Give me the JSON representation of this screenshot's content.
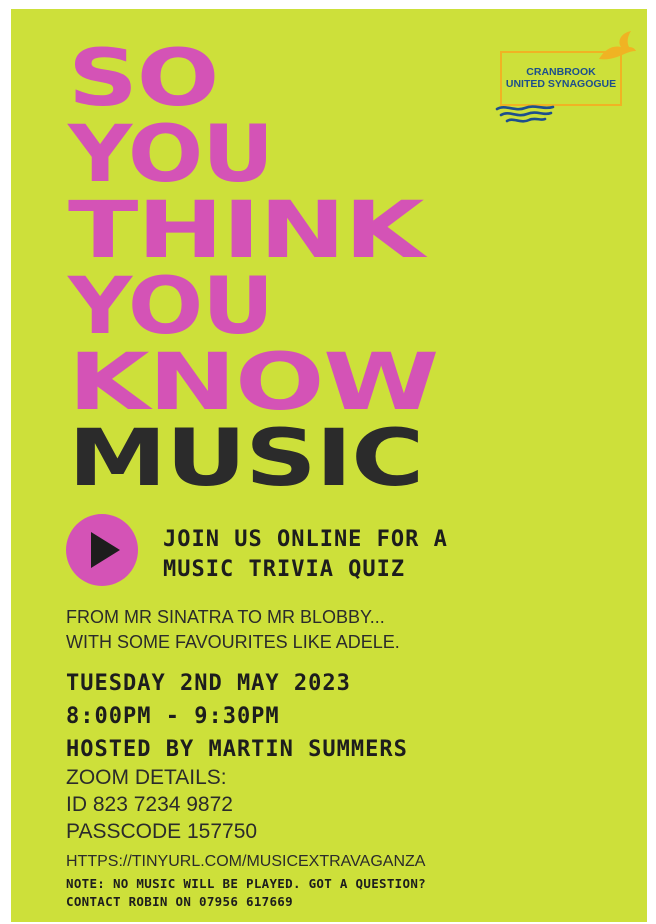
{
  "headline": {
    "lines": [
      "SO",
      "YOU",
      "THINK",
      "YOU",
      "KNOW"
    ],
    "last_line": "MUSIC"
  },
  "logo": {
    "line1": "CRANBROOK",
    "line2": "UNITED SYNAGOGUE"
  },
  "join": {
    "line1": "JOIN US ONLINE FOR A",
    "line2": "MUSIC TRIVIA QUIZ"
  },
  "tagline": {
    "line1": "FROM MR SINATRA TO MR BLOBBY...",
    "line2": "WITH SOME FAVOURITES LIKE ADELE."
  },
  "event": {
    "date": "TUESDAY 2ND MAY 2023",
    "time": "8:00PM - 9:30PM",
    "host": "HOSTED BY MARTIN SUMMERS"
  },
  "zoom": {
    "heading": "ZOOM DETAILS:",
    "id": "ID 823 7234 9872",
    "passcode": "PASSCODE 157750",
    "url": "HTTPS://TINYURL.COM/MUSICEXTRAVAGANZA"
  },
  "note": {
    "line1": "NOTE: NO MUSIC WILL BE PLAYED. GOT A QUESTION?",
    "line2": "CONTACT ROBIN ON 07956 617669"
  },
  "colors": {
    "background": "#cde03a",
    "accent": "#d453b6",
    "dark_text": "#2b2b2b",
    "logo_blue": "#1d4f8c",
    "logo_gold": "#f0b323"
  },
  "icons": {
    "play": "play-icon",
    "logo_bird": "bird-icon",
    "logo_waves": "waves-icon"
  }
}
